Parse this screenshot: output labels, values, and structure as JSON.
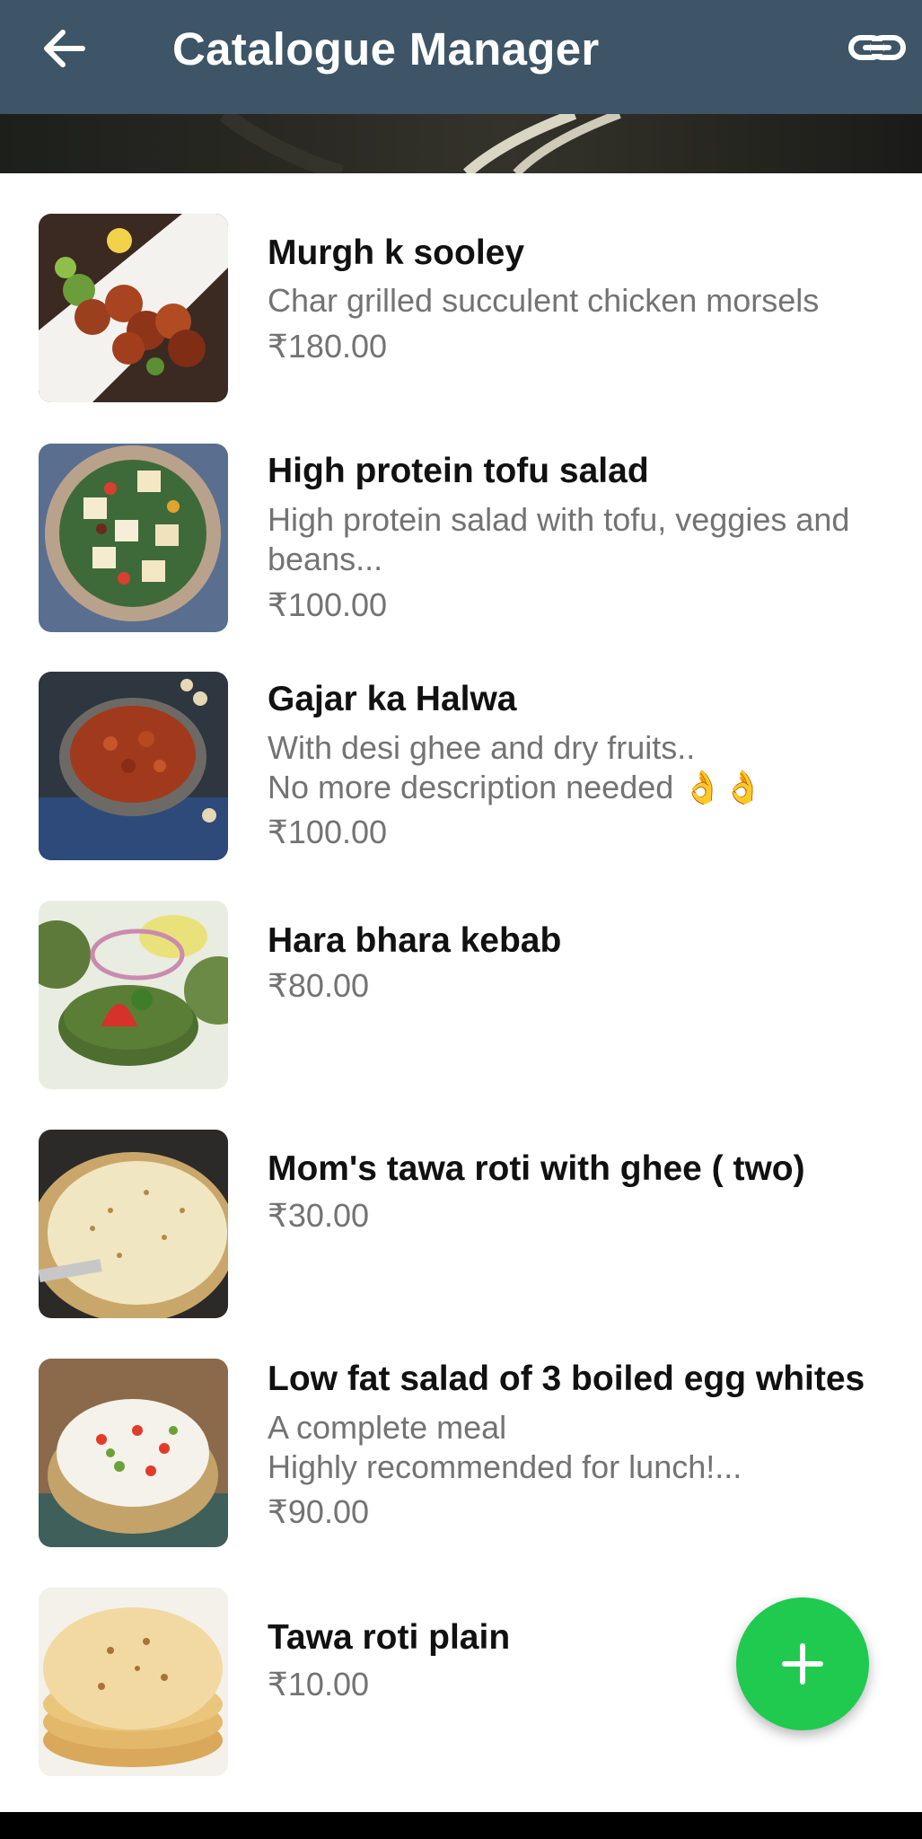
{
  "header": {
    "title": "Catalogue Manager",
    "back_icon": "arrow-left-icon",
    "link_icon": "link-icon",
    "background": "#3d5566"
  },
  "items": [
    {
      "name": "Murgh k sooley",
      "desc1": "Char grilled succulent chicken morsels",
      "desc2": "",
      "price": "₹180.00"
    },
    {
      "name": "High protein tofu salad",
      "desc1": "High protein salad with tofu, veggies and",
      "desc2": "beans...",
      "price": "₹100.00"
    },
    {
      "name": "Gajar ka Halwa",
      "desc1": "With desi ghee and dry fruits..",
      "desc2": "No more description needed 👌👌",
      "price": "₹100.00"
    },
    {
      "name": "Hara bhara kebab",
      "desc1": "",
      "desc2": "",
      "price": "₹80.00"
    },
    {
      "name": "Mom's tawa roti with ghee ( two)",
      "desc1": "",
      "desc2": "",
      "price": "₹30.00"
    },
    {
      "name": "Low fat salad of 3 boiled egg whites",
      "desc1": "A complete meal",
      "desc2": "Highly recommended for lunch!...",
      "price": "₹90.00"
    },
    {
      "name": "Tawa roti plain",
      "desc1": "",
      "desc2": "",
      "price": "₹10.00"
    }
  ],
  "fab": {
    "icon": "plus-icon",
    "color": "#1fca4f"
  }
}
